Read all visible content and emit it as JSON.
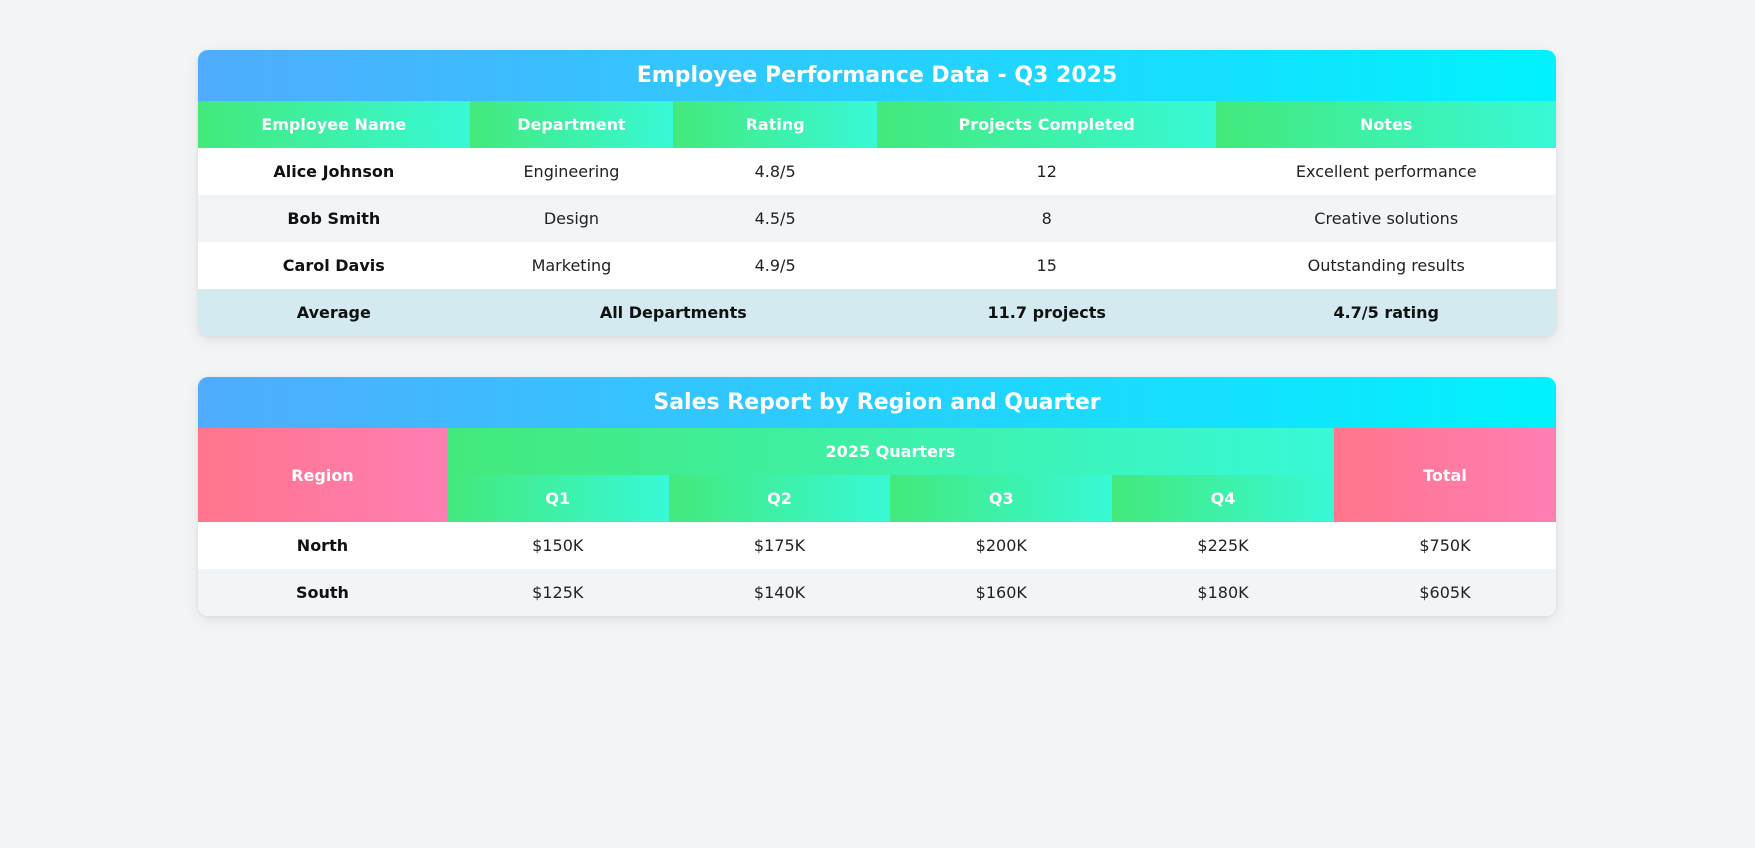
{
  "employees": {
    "title": "Employee Performance Data - Q3 2025",
    "headers": {
      "name": "Employee Name",
      "department": "Department",
      "rating": "Rating",
      "projects": "Projects Completed",
      "notes": "Notes"
    },
    "rows": [
      {
        "name": "Alice Johnson",
        "department": "Engineering",
        "rating": "4.8/5",
        "projects": "12",
        "notes": "Excellent performance"
      },
      {
        "name": "Bob Smith",
        "department": "Design",
        "rating": "4.5/5",
        "projects": "8",
        "notes": "Creative solutions"
      },
      {
        "name": "Carol Davis",
        "department": "Marketing",
        "rating": "4.9/5",
        "projects": "15",
        "notes": "Outstanding results"
      }
    ],
    "footer": {
      "label": "Average",
      "departments": "All Departments",
      "projects": "11.7 projects",
      "rating": "4.7/5 rating"
    }
  },
  "sales": {
    "title": "Sales Report by Region and Quarter",
    "headers": {
      "region": "Region",
      "quarters_group": "2025 Quarters",
      "total": "Total",
      "quarters": [
        "Q1",
        "Q2",
        "Q3",
        "Q4"
      ]
    },
    "rows": [
      {
        "region": "North",
        "values": [
          "$150K",
          "$175K",
          "$200K",
          "$225K"
        ],
        "total": "$750K"
      },
      {
        "region": "South",
        "values": [
          "$125K",
          "$140K",
          "$160K",
          "$180K"
        ],
        "total": "$605K"
      }
    ]
  },
  "colors": {
    "caption_gradient": [
      "#4facfe",
      "#00f2fe"
    ],
    "header_gradient": [
      "#43e97b",
      "#38f9d7"
    ],
    "pink_header_gradient": [
      "#ff758c",
      "#ff7eb3"
    ],
    "footer_row": "#d3eaf0",
    "striped_row": "#f1f5f8",
    "page_background": "#f3f4f6"
  }
}
